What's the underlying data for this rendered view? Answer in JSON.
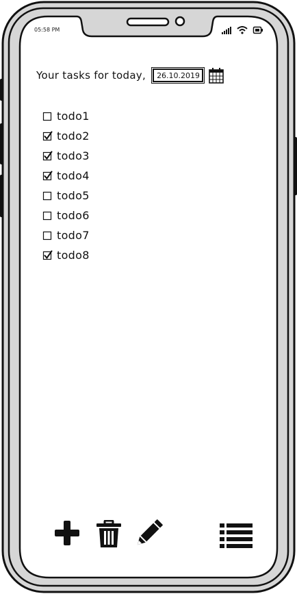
{
  "status_bar": {
    "time": "05:58 PM",
    "icons": [
      "signal-icon",
      "wifi-icon",
      "battery-icon"
    ]
  },
  "header": {
    "title": "Your tasks for today,",
    "date_value": "26.10.2019",
    "calendar_icon": "calendar-icon"
  },
  "todos": [
    {
      "label": "todo1",
      "checked": false
    },
    {
      "label": "todo2",
      "checked": true
    },
    {
      "label": "todo3",
      "checked": true
    },
    {
      "label": "todo4",
      "checked": true
    },
    {
      "label": "todo5",
      "checked": false
    },
    {
      "label": "todo6",
      "checked": false
    },
    {
      "label": "todo7",
      "checked": false
    },
    {
      "label": "todo8",
      "checked": true
    }
  ],
  "toolbar": {
    "icons": [
      "plus-icon",
      "trash-icon",
      "pencil-icon",
      "list-icon"
    ]
  },
  "colors": {
    "frame": "#d6d6d6",
    "ink": "#111111",
    "screen": "#ffffff"
  }
}
